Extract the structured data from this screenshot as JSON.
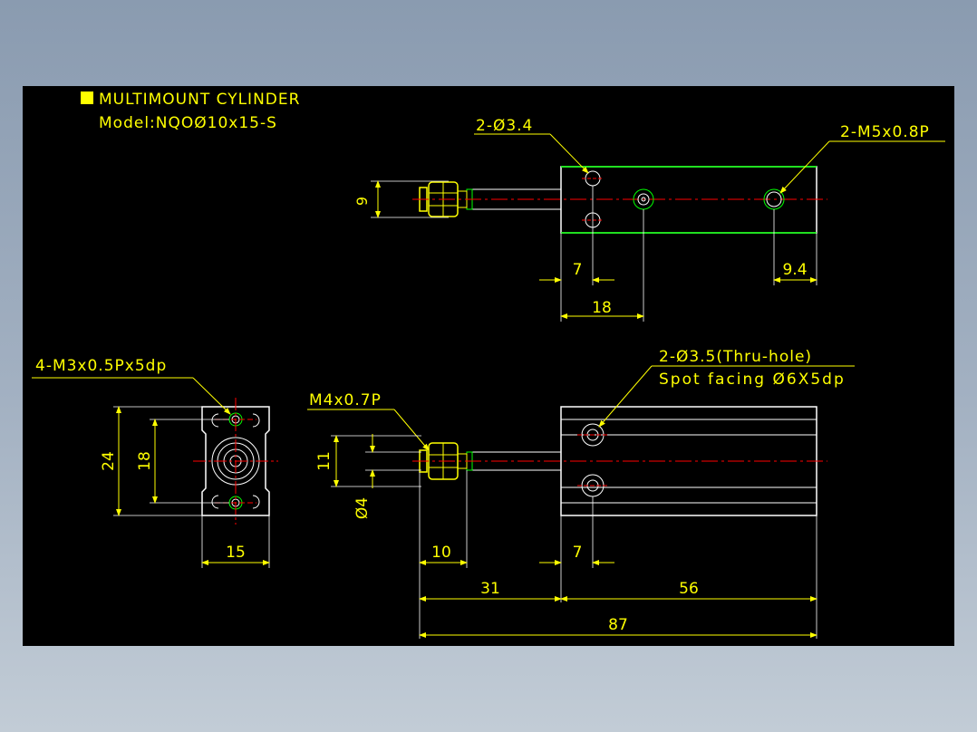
{
  "title_block": {
    "title": "MULTIMOUNT CYLINDER",
    "model": "Model:NQOØ10x15-S"
  },
  "colors": {
    "background": "#000000",
    "outline": "#ffffff",
    "dimension": "#ffff00",
    "centerline": "#ff0000",
    "green": "#00ff00",
    "desktop": "#9aaabb"
  },
  "top_view": {
    "hole_callout": "2-Ø3.4",
    "thread_callout": "2-M5x0.8P",
    "dim_9": "9",
    "dim_7": "7",
    "dim_18": "18",
    "dim_9_4": "9.4"
  },
  "end_view": {
    "tap_callout": "4-M3x0.5Px5dp",
    "dim_24": "24",
    "dim_18": "18",
    "dim_15": "15"
  },
  "side_view": {
    "hole_callout": "2-Ø3.5(Thru-hole)",
    "spot_facing": "Spot facing Ø6X5dp",
    "thread_callout": "M4x0.7P",
    "dim_11": "11",
    "dim_d4": "Ø4",
    "dim_10": "10",
    "dim_7": "7",
    "dim_31": "31",
    "dim_56": "56",
    "dim_87": "87"
  }
}
